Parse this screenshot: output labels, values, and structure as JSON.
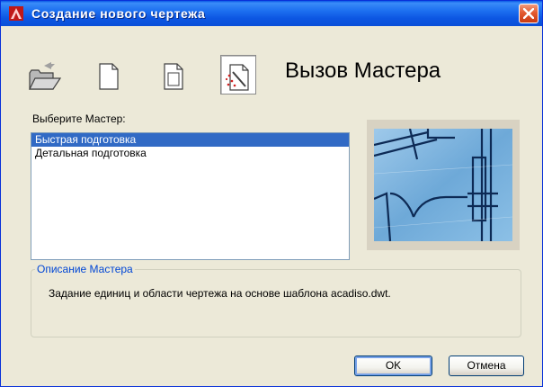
{
  "window": {
    "title": "Создание нового чертежа",
    "icon": "autocad-logo-icon",
    "close_icon": "close-icon"
  },
  "toolbar": {
    "buttons": [
      {
        "icon": "open-folder-icon"
      },
      {
        "icon": "blank-drawing-icon"
      },
      {
        "icon": "template-drawing-icon"
      },
      {
        "icon": "wizard-icon",
        "selected": true
      }
    ]
  },
  "heading": "Вызов Мастера",
  "wizard_list": {
    "label": "Выберите Мастер:",
    "items": [
      {
        "label": "Быстрая подготовка",
        "selected": true
      },
      {
        "label": "Детальная подготовка",
        "selected": false
      }
    ]
  },
  "description": {
    "legend": "Описание Мастера",
    "text": "Задание единиц и области чертежа на основе шаблона acadiso.dwt."
  },
  "buttons": {
    "ok": "OK",
    "cancel": "Отмена"
  },
  "colors": {
    "titlebar": "#0a58e6",
    "selection": "#316ac5",
    "legend": "#0046d5",
    "close": "#e35a30"
  }
}
